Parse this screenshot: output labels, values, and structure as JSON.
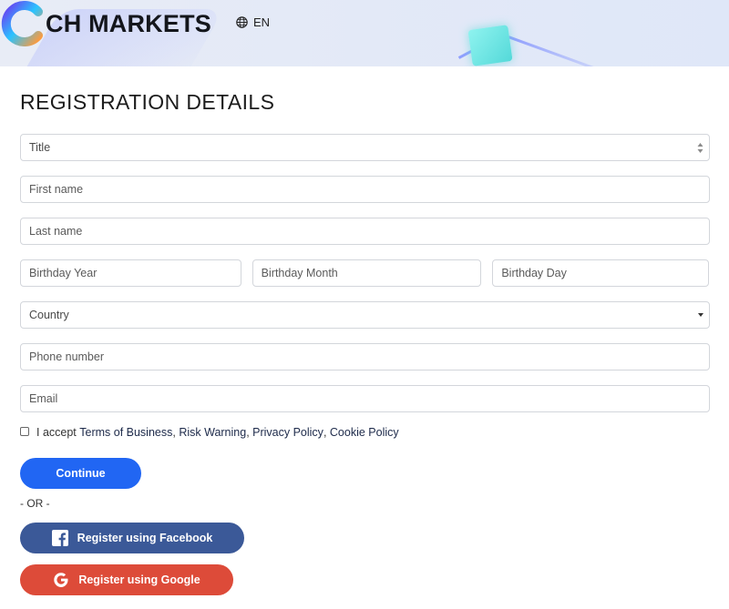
{
  "header": {
    "brand": "CH MARKETS",
    "language": "EN"
  },
  "page": {
    "title": "REGISTRATION DETAILS"
  },
  "form": {
    "title_select": "Title",
    "first_name_placeholder": "First name",
    "last_name_placeholder": "Last name",
    "birthday_year_placeholder": "Birthday Year",
    "birthday_month_placeholder": "Birthday Month",
    "birthday_day_placeholder": "Birthday Day",
    "country_select": "Country",
    "phone_placeholder": "Phone number",
    "email_placeholder": "Email"
  },
  "terms": {
    "prefix": "I accept ",
    "links": [
      "Terms of Business",
      "Risk Warning",
      "Privacy Policy",
      "Cookie Policy"
    ],
    "separator": ", "
  },
  "actions": {
    "continue_label": "Continue",
    "or_label": "- OR -",
    "facebook_label": "Register using Facebook",
    "google_label": "Register using Google"
  },
  "colors": {
    "primary": "#2166f3",
    "facebook": "#3b5998",
    "google": "#dd4b39"
  },
  "icons": {
    "language": "globe-icon",
    "facebook": "facebook-icon",
    "google": "google-icon"
  }
}
